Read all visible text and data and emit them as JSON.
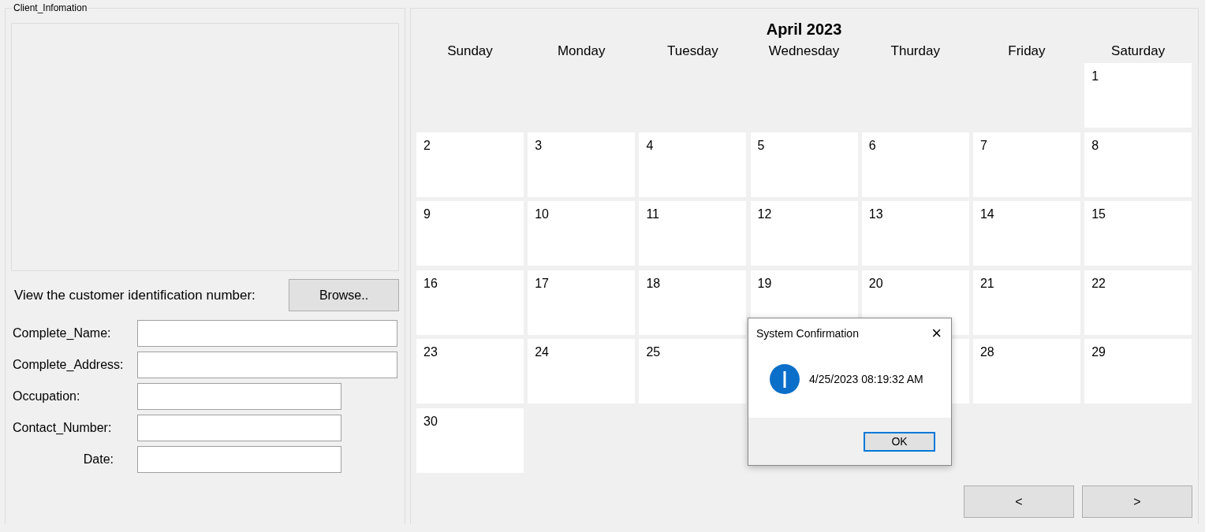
{
  "client_group": {
    "title": "Client_Infomation",
    "id_prompt": "View the customer identification number:",
    "browse_button": "Browse..",
    "fields": [
      {
        "label": "Complete_Name:"
      },
      {
        "label": "Complete_Address:"
      },
      {
        "label": "Occupation:"
      },
      {
        "label": "Contact_Number:"
      },
      {
        "label": "Date:"
      }
    ]
  },
  "calendar": {
    "title": "April 2023",
    "weekdays": [
      "Sunday",
      "Monday",
      "Tuesday",
      "Wednesday",
      "Thurday",
      "Friday",
      "Saturday"
    ],
    "weeks": [
      [
        {
          "kind": "empty"
        },
        {
          "kind": "empty"
        },
        {
          "kind": "empty"
        },
        {
          "kind": "empty"
        },
        {
          "kind": "empty"
        },
        {
          "kind": "empty"
        },
        {
          "kind": "day",
          "label": "1"
        }
      ],
      [
        {
          "kind": "day",
          "label": "2"
        },
        {
          "kind": "day",
          "label": "3"
        },
        {
          "kind": "day",
          "label": "4"
        },
        {
          "kind": "day",
          "label": "5"
        },
        {
          "kind": "day",
          "label": "6"
        },
        {
          "kind": "day",
          "label": "7"
        },
        {
          "kind": "day",
          "label": "8"
        }
      ],
      [
        {
          "kind": "day",
          "label": "9"
        },
        {
          "kind": "day",
          "label": "10"
        },
        {
          "kind": "day",
          "label": "11"
        },
        {
          "kind": "day",
          "label": "12"
        },
        {
          "kind": "day",
          "label": "13"
        },
        {
          "kind": "day",
          "label": "14"
        },
        {
          "kind": "day",
          "label": "15"
        }
      ],
      [
        {
          "kind": "day",
          "label": "16"
        },
        {
          "kind": "day",
          "label": "17"
        },
        {
          "kind": "day",
          "label": "18"
        },
        {
          "kind": "day",
          "label": "19"
        },
        {
          "kind": "day",
          "label": "20"
        },
        {
          "kind": "day",
          "label": "21"
        },
        {
          "kind": "day",
          "label": "22"
        }
      ],
      [
        {
          "kind": "day",
          "label": "23"
        },
        {
          "kind": "day",
          "label": "24"
        },
        {
          "kind": "day",
          "label": "25"
        },
        {
          "kind": "hidden"
        },
        {
          "kind": "covered"
        },
        {
          "kind": "day",
          "label": "28"
        },
        {
          "kind": "day",
          "label": "29"
        }
      ],
      [
        {
          "kind": "day",
          "label": "30"
        },
        {
          "kind": "empty"
        },
        {
          "kind": "empty"
        },
        {
          "kind": "empty"
        },
        {
          "kind": "empty"
        },
        {
          "kind": "empty"
        },
        {
          "kind": "empty"
        }
      ]
    ],
    "prev_button": "<",
    "next_button": ">"
  },
  "dialog": {
    "title": "System Confirmation",
    "close": "×",
    "message": "4/25/2023 08:19:32 AM",
    "ok_button": "OK"
  }
}
